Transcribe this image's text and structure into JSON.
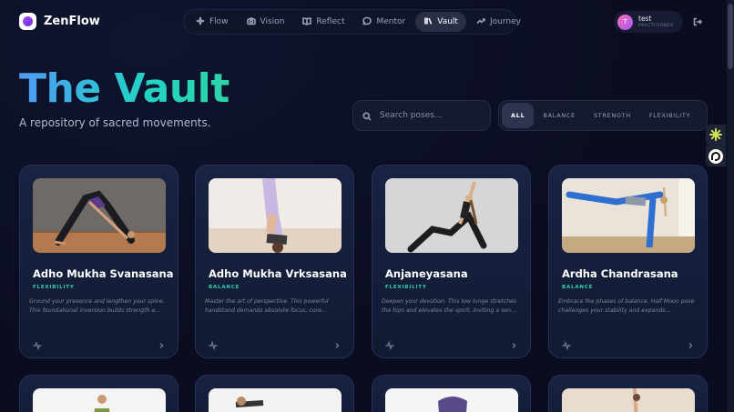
{
  "app": {
    "name": "ZenFlow"
  },
  "nav": [
    {
      "label": "Flow",
      "icon": "sparkle-icon",
      "active": false
    },
    {
      "label": "Vision",
      "icon": "camera-icon",
      "active": false
    },
    {
      "label": "Reflect",
      "icon": "book-icon",
      "active": false
    },
    {
      "label": "Mentor",
      "icon": "chat-icon",
      "active": false
    },
    {
      "label": "Vault",
      "icon": "library-icon",
      "active": true
    },
    {
      "label": "Journey",
      "icon": "trend-icon",
      "active": false
    }
  ],
  "user": {
    "initial": "T",
    "name": "test",
    "role": "PRACTITIONER"
  },
  "hero": {
    "title": "The Vault",
    "subtitle": "A repository of sacred movements."
  },
  "search": {
    "placeholder": "Search poses..."
  },
  "filters": [
    {
      "label": "ALL",
      "active": true
    },
    {
      "label": "BALANCE",
      "active": false
    },
    {
      "label": "STRENGTH",
      "active": false
    },
    {
      "label": "FLEXIBILITY",
      "active": false
    }
  ],
  "poses": [
    {
      "name": "Adho Mukha Svanasana",
      "category": "FLEXIBILITY",
      "description": "Ground your presence and lengthen your spine. This foundational inversion builds strength a..."
    },
    {
      "name": "Adho Mukha Vrksasana",
      "category": "BALANCE",
      "description": "Master the art of perspective. This powerful handstand demands absolute focus, core..."
    },
    {
      "name": "Anjaneyasana",
      "category": "FLEXIBILITY",
      "description": "Deepen your devotion. This low lunge stretches the hips and elevates the spirit, inviting a sen..."
    },
    {
      "name": "Ardha Chandrasana",
      "category": "BALANCE",
      "description": "Embrace the phases of balance. Half Moon pose challenges your stability and expands..."
    }
  ],
  "colors": {
    "accent": "#2dd4a8",
    "background": "#0a0d1f",
    "card": "#182343"
  }
}
